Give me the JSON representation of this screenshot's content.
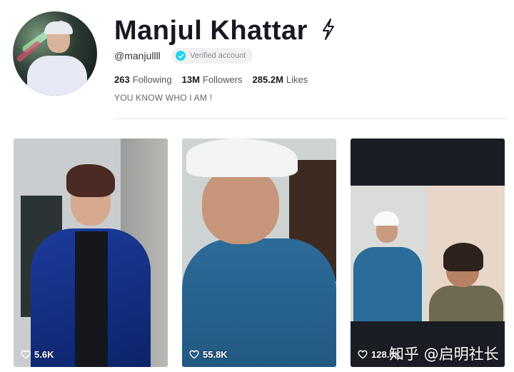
{
  "profile": {
    "display_name": "Manjul Khattar",
    "username": "@manjullll",
    "verified_label": "Verified account",
    "bio": "YOU KNOW WHO I AM !",
    "stats": {
      "following_count": "263",
      "following_label": "Following",
      "followers_count": "13M",
      "followers_label": "Followers",
      "likes_count": "285.2M",
      "likes_label": "Likes"
    }
  },
  "videos": [
    {
      "likes": "5.6K",
      "icon": "heart-icon"
    },
    {
      "likes": "55.8K",
      "icon": "heart-icon"
    },
    {
      "likes": "128.6K",
      "icon": "heart-icon"
    }
  ],
  "watermark": "知乎 @启明社长",
  "colors": {
    "verified_badge": "#20d5ec",
    "text_primary": "#161823",
    "text_secondary": "#666666"
  }
}
